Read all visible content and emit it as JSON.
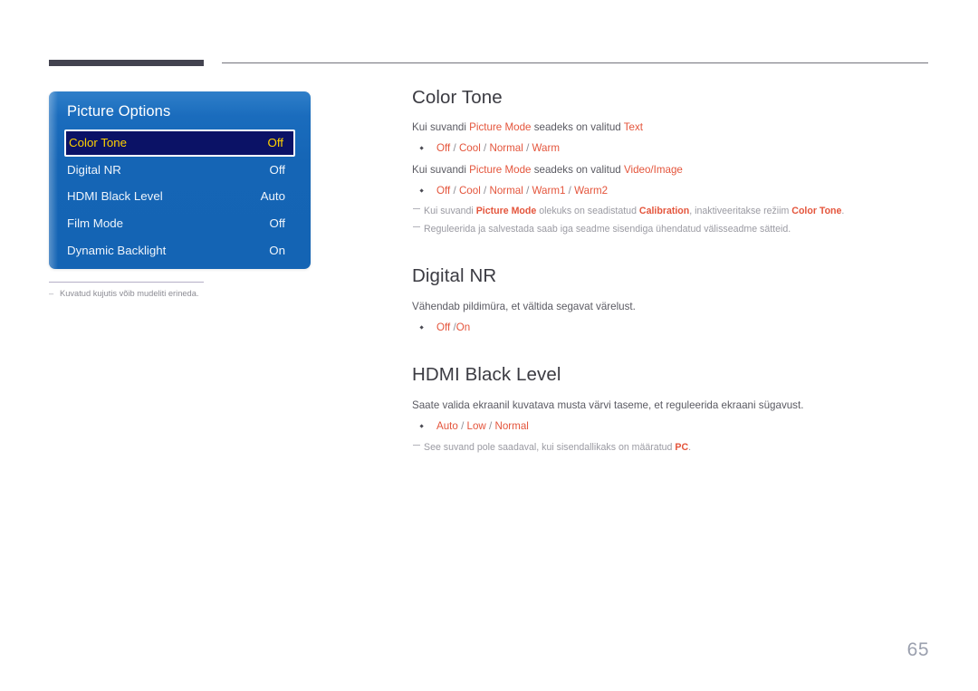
{
  "page": {
    "number": "65",
    "language": "Estonian"
  },
  "osd": {
    "title": "Picture Options",
    "rows": [
      {
        "label": "Color Tone",
        "value": "Off",
        "selected": true
      },
      {
        "label": "Digital NR",
        "value": "Off",
        "selected": false
      },
      {
        "label": "HDMI Black Level",
        "value": "Auto",
        "selected": false
      },
      {
        "label": "Film Mode",
        "value": "Off",
        "selected": false
      },
      {
        "label": "Dynamic Backlight",
        "value": "On",
        "selected": false
      }
    ]
  },
  "caption": {
    "text": "Kuvatud kujutis võib mudeliti erineda."
  },
  "sections": [
    {
      "title": "Color Tone",
      "lines": [
        {
          "parts": [
            {
              "t": "Kui suvandi ",
              "s": "plain"
            },
            {
              "t": "Picture Mode",
              "s": "hl"
            },
            {
              "t": " seadeks on valitud ",
              "s": "plain"
            },
            {
              "t": "Text",
              "s": "hl"
            }
          ]
        }
      ],
      "options_1": [
        {
          "t": "Off",
          "s": "hl"
        },
        {
          "t": " / ",
          "s": "sep"
        },
        {
          "t": "Cool",
          "s": "hl"
        },
        {
          "t": " / ",
          "s": "sep"
        },
        {
          "t": "Normal",
          "s": "hl"
        },
        {
          "t": " / ",
          "s": "sep"
        },
        {
          "t": "Warm",
          "s": "hl"
        }
      ],
      "line_2": [
        {
          "t": "Kui suvandi ",
          "s": "plain"
        },
        {
          "t": "Picture Mode",
          "s": "hl"
        },
        {
          "t": " seadeks on valitud ",
          "s": "plain"
        },
        {
          "t": "Video/Image",
          "s": "hl"
        }
      ],
      "options_2": [
        {
          "t": "Off",
          "s": "hl"
        },
        {
          "t": " / ",
          "s": "sep"
        },
        {
          "t": "Cool",
          "s": "hl"
        },
        {
          "t": " / ",
          "s": "sep"
        },
        {
          "t": "Normal",
          "s": "hl"
        },
        {
          "t": " / ",
          "s": "sep"
        },
        {
          "t": "Warm1",
          "s": "hl"
        },
        {
          "t": " / ",
          "s": "sep"
        },
        {
          "t": "Warm2",
          "s": "hl"
        }
      ],
      "notes": [
        [
          {
            "t": "Kui suvandi ",
            "s": "plain"
          },
          {
            "t": "Picture Mode",
            "s": "hlb"
          },
          {
            "t": " olekuks on seadistatud ",
            "s": "plain"
          },
          {
            "t": "Calibration",
            "s": "hlb"
          },
          {
            "t": ", inaktiveeritakse režiim ",
            "s": "plain"
          },
          {
            "t": "Color Tone",
            "s": "hlb"
          },
          {
            "t": ".",
            "s": "plain"
          }
        ],
        [
          {
            "t": "Reguleerida ja salvestada saab iga seadme sisendiga ühendatud välisseadme sätteid.",
            "s": "plain"
          }
        ]
      ]
    },
    {
      "title": "Digital NR",
      "desc": "Vähendab pildimüra, et vältida segavat värelust.",
      "options": [
        {
          "t": "Off",
          "s": "hl"
        },
        {
          "t": " /",
          "s": "sep"
        },
        {
          "t": "On",
          "s": "hl"
        }
      ]
    },
    {
      "title": "HDMI Black Level",
      "desc": "Saate valida ekraanil kuvatava musta värvi taseme, et reguleerida ekraani sügavust.",
      "options": [
        {
          "t": "Auto",
          "s": "hl"
        },
        {
          "t": " / ",
          "s": "sep"
        },
        {
          "t": "Low",
          "s": "hl"
        },
        {
          "t": " / ",
          "s": "sep"
        },
        {
          "t": "Normal",
          "s": "hl"
        }
      ],
      "notes": [
        [
          {
            "t": "See suvand pole saadaval, kui sisendallikaks on määratud ",
            "s": "plain"
          },
          {
            "t": "PC",
            "s": "hlb"
          },
          {
            "t": ".",
            "s": "plain"
          }
        ]
      ]
    }
  ],
  "colors": {
    "accent": "#e4553c",
    "osd_panel_top": "#2f7fc9",
    "osd_panel_bottom": "#1464b4",
    "osd_selected_bg": "#0b1266",
    "osd_selected_text": "#ffd100",
    "header_bar": "#434350",
    "heading": "#3b3b42",
    "body_text": "#5a5a62",
    "note_text": "#9a9aa2",
    "page_number": "#9ba0ae"
  }
}
